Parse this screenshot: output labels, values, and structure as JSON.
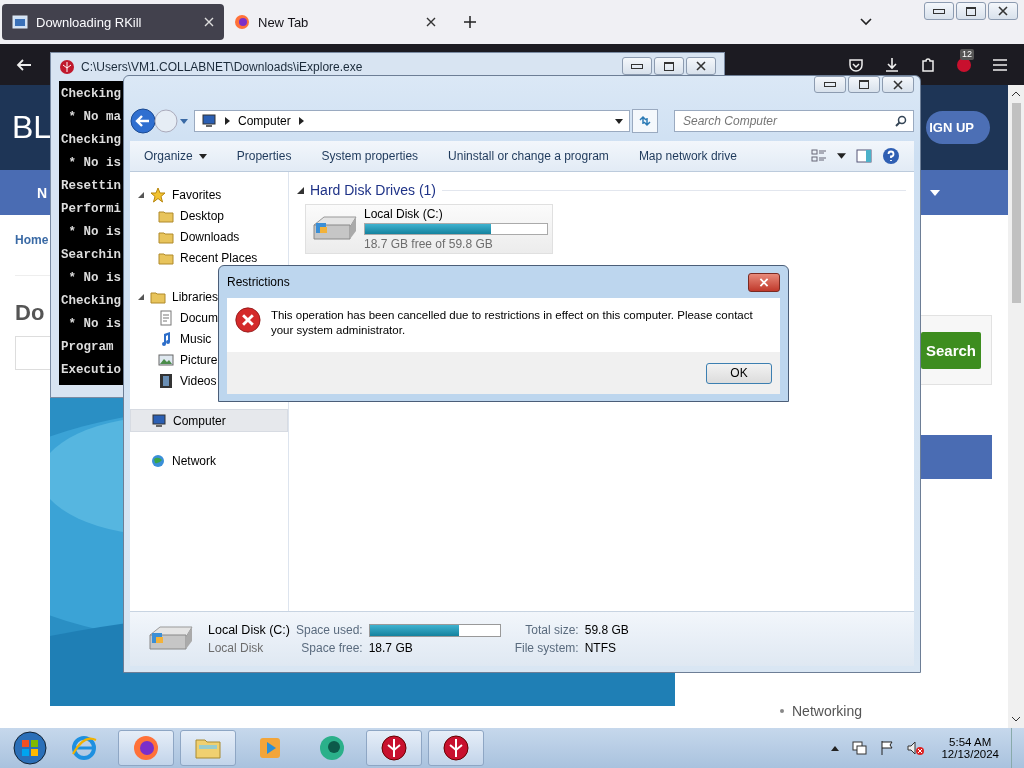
{
  "browser": {
    "tabs": [
      {
        "label": "Downloading RKill",
        "selected": true
      },
      {
        "label": "New Tab",
        "selected": false
      }
    ],
    "extension_badge": "12"
  },
  "website": {
    "logo": "BL",
    "signup": "IGN UP",
    "nav_left": "N",
    "breadcrumb": "Home",
    "heading": "Do",
    "search_button": "Search",
    "links": [
      "Networking"
    ]
  },
  "console": {
    "title": "C:\\Users\\VM1.COLLABNET\\Downloads\\iExplore.exe",
    "lines": [
      "Checking",
      " * No ma",
      "Checking",
      " * No is",
      "Resettin",
      "Performi",
      " * No is",
      "Searchin",
      " * No is",
      "Checking",
      " * No is",
      "Program ",
      "Executio"
    ]
  },
  "explorer": {
    "breadcrumb": "Computer",
    "search": {
      "placeholder": "Search Computer"
    },
    "toolbar": [
      {
        "label": "Organize",
        "menu": true
      },
      {
        "label": "Properties",
        "menu": false
      },
      {
        "label": "System properties",
        "menu": false
      },
      {
        "label": "Uninstall or change a program",
        "menu": false
      },
      {
        "label": "Map network drive",
        "menu": false
      }
    ],
    "nav": [
      {
        "label": "Favorites",
        "expanded": true,
        "selected": false,
        "children": [
          {
            "label": "Desktop",
            "selected": false
          },
          {
            "label": "Downloads",
            "selected": false
          },
          {
            "label": "Recent Places",
            "selected": false
          }
        ]
      },
      {
        "label": "Libraries",
        "expanded": true,
        "selected": false,
        "children": [
          {
            "label": "Docum",
            "selected": false
          },
          {
            "label": "Music",
            "selected": false
          },
          {
            "label": "Picture",
            "selected": false
          },
          {
            "label": "Videos",
            "selected": false
          }
        ]
      },
      {
        "label": "Computer",
        "selected": true
      },
      {
        "label": "Network",
        "selected": false
      }
    ],
    "group": {
      "title": "Hard Disk Drives (1)",
      "expanded": true
    },
    "drive": {
      "name": "Local Disk (C:)",
      "level": 0.69,
      "free_text": "18.7 GB free of 59.8 GB"
    },
    "details": {
      "name": "Local Disk (C:)",
      "type": "Local Disk",
      "used_label": "Space used:",
      "level": 0.69,
      "free_label": "Space free:",
      "free": "18.7 GB",
      "total_label": "Total size:",
      "total": "59.8 GB",
      "fs_label": "File system:",
      "fs": "NTFS"
    }
  },
  "dialog": {
    "title": "Restrictions",
    "message": "This operation has been cancelled due to restrictions in effect on this computer. Please contact your system administrator.",
    "button": "OK"
  },
  "taskbar": {
    "time": "5:54 AM",
    "date": "12/13/2024"
  }
}
